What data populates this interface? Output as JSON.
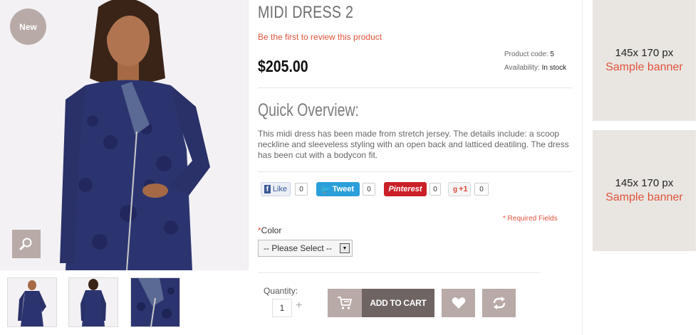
{
  "product": {
    "badge": "New",
    "title": "MIDI DRESS 2",
    "review_link": "Be the first to review this product",
    "price": "$205.00",
    "code_label": "Product code:",
    "code_value": "5",
    "availability_label": "Availability:",
    "availability_value": "In stock",
    "overview_title": "Quick Overview:",
    "description": "This midi dress has been made from stretch jersey. The details include: a scoop neckline and sleeveless styling with an open back and latticed deatiling. The dress has been cut with a bodycon fit."
  },
  "social": {
    "like_label": "Like",
    "like_count": "0",
    "tweet_label": "Tweet",
    "tweet_count": "0",
    "pinterest_label": "Pinterest",
    "pinterest_count": "0",
    "gplus_label": "+1",
    "gplus_count": "0"
  },
  "options": {
    "required_note": "* Required Fields",
    "color_star": "*",
    "color_label": "Color",
    "color_selected": "-- Please Select --"
  },
  "purchase": {
    "quantity_label": "Quantity:",
    "quantity_value": "1",
    "plus": "+",
    "add_to_cart": "ADD TO CART"
  },
  "banners": [
    {
      "size": "145x 170 px",
      "label": "Sample banner"
    },
    {
      "size": "145x 170 px",
      "label": "Sample banner"
    }
  ],
  "icons": [
    "search-icon",
    "cart-icon",
    "heart-icon",
    "compare-icon",
    "facebook-icon",
    "twitter-icon",
    "google-plus-icon"
  ],
  "colors": {
    "accent": "#e0533b",
    "taupe": "#b8aaa6",
    "dark_taupe": "#6e6462",
    "banner_bg": "#e9e6e2"
  }
}
